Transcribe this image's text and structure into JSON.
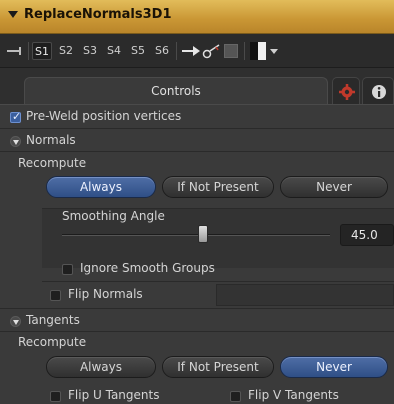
{
  "title": "ReplaceNormals3D1",
  "toolbar": {
    "slots": [
      "S1",
      "S2",
      "S3",
      "S4",
      "S5",
      "S6"
    ]
  },
  "tabs": {
    "controls": "Controls"
  },
  "colors": {
    "title_bar": "#c99634",
    "selected_button": "#3b5f9e"
  },
  "pre_weld": {
    "label": "Pre-Weld position vertices",
    "checked": true
  },
  "normals": {
    "header": "Normals",
    "recompute_label": "Recompute",
    "options": [
      "Always",
      "If Not Present",
      "Never"
    ],
    "selected": "Always",
    "smoothing_label": "Smoothing Angle",
    "smoothing_value": "45.0",
    "ignore_smooth_groups": "Ignore Smooth Groups",
    "flip_normals": "Flip Normals"
  },
  "tangents": {
    "header": "Tangents",
    "recompute_label": "Recompute",
    "options": [
      "Always",
      "If Not Present",
      "Never"
    ],
    "selected": "Never",
    "flip_u": "Flip U Tangents",
    "flip_v": "Flip V Tangents"
  }
}
